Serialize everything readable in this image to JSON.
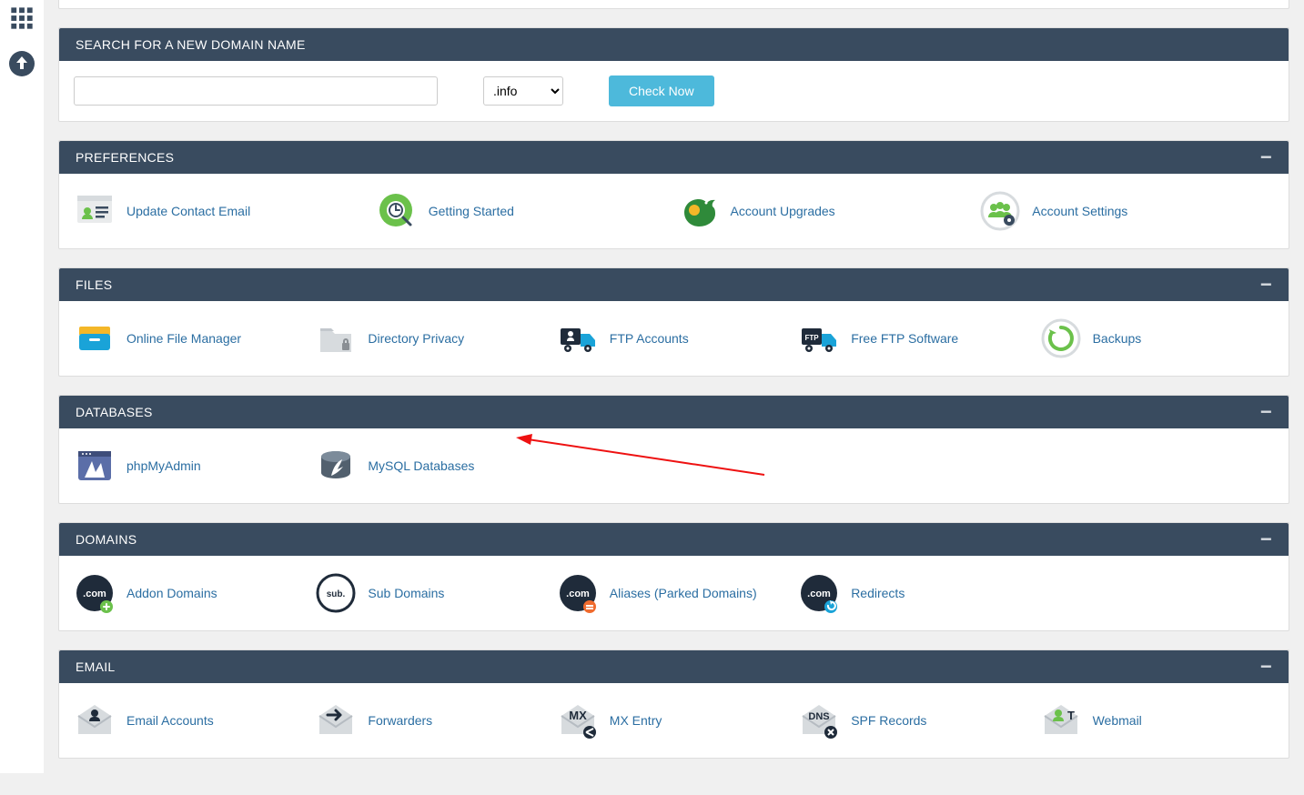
{
  "search": {
    "header": "SEARCH FOR A NEW DOMAIN NAME",
    "tld": ".info",
    "check_label": "Check Now"
  },
  "preferences": {
    "header": "PREFERENCES",
    "items": [
      {
        "label": "Update Contact Email"
      },
      {
        "label": "Getting Started"
      },
      {
        "label": "Account Upgrades"
      },
      {
        "label": "Account Settings"
      }
    ]
  },
  "files": {
    "header": "FILES",
    "items": [
      {
        "label": "Online File Manager"
      },
      {
        "label": "Directory Privacy"
      },
      {
        "label": "FTP Accounts"
      },
      {
        "label": "Free FTP Software"
      },
      {
        "label": "Backups"
      }
    ]
  },
  "databases": {
    "header": "DATABASES",
    "items": [
      {
        "label": "phpMyAdmin"
      },
      {
        "label": "MySQL Databases"
      }
    ]
  },
  "domains": {
    "header": "DOMAINS",
    "items": [
      {
        "label": "Addon Domains"
      },
      {
        "label": "Sub Domains"
      },
      {
        "label": "Aliases (Parked Domains)"
      },
      {
        "label": "Redirects"
      }
    ]
  },
  "email": {
    "header": "EMAIL",
    "items": [
      {
        "label": "Email Accounts"
      },
      {
        "label": "Forwarders"
      },
      {
        "label": "MX Entry"
      },
      {
        "label": "SPF Records"
      },
      {
        "label": "Webmail"
      }
    ]
  }
}
